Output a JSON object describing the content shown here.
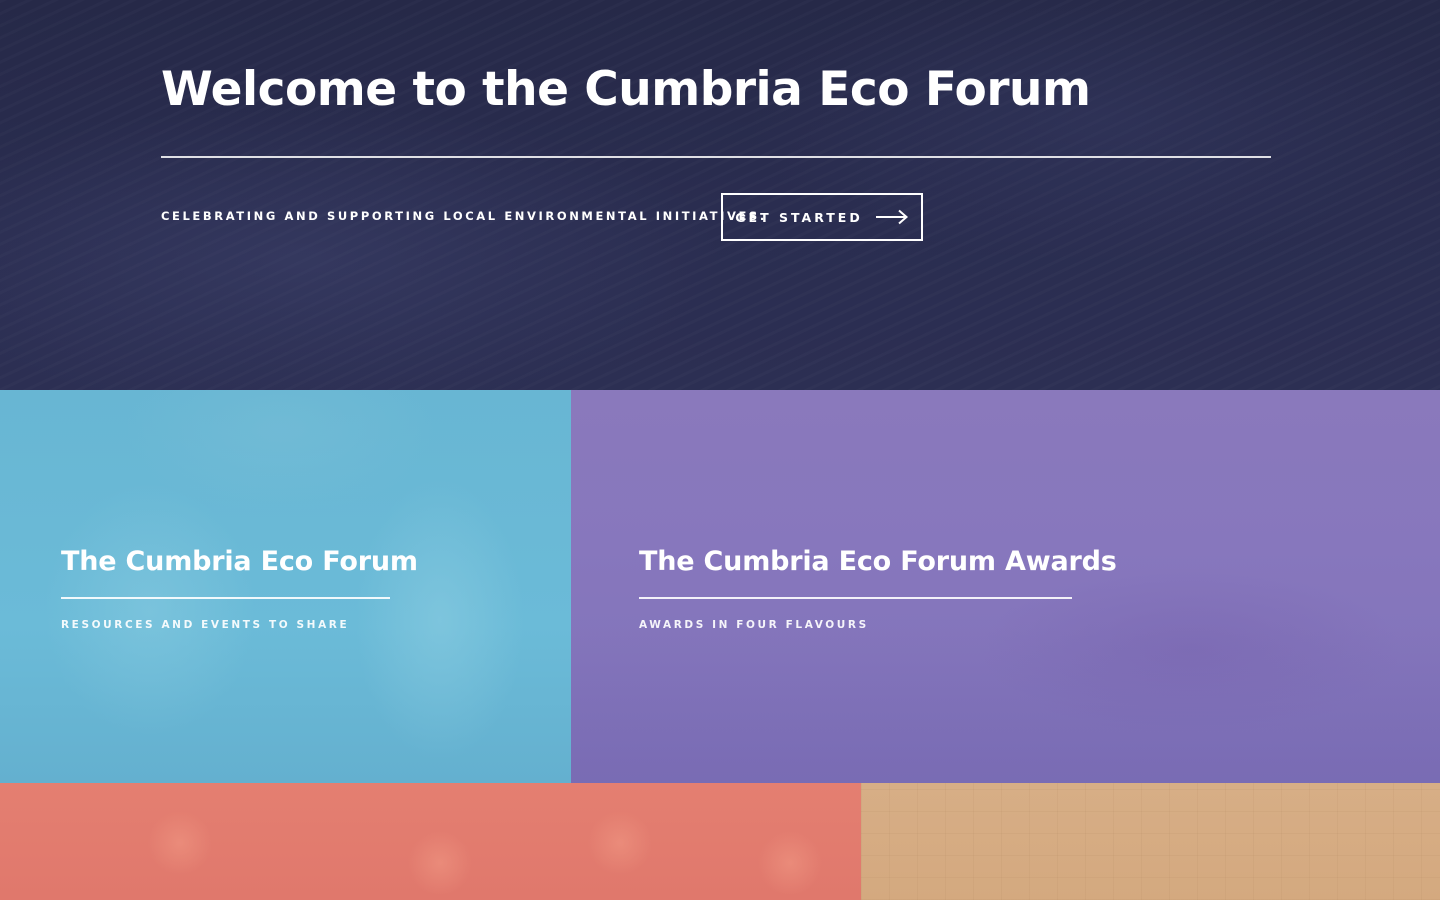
{
  "hero": {
    "title": "Welcome to the Cumbria Eco Forum",
    "tagline": "CELEBRATING AND SUPPORTING LOCAL ENVIRONMENTAL INITIATIVES.",
    "cta_label": "GET STARTED",
    "cta_icon": "arrow-right-icon"
  },
  "tiles": [
    {
      "title": "The Cumbria Eco Forum",
      "subtitle": "RESOURCES AND EVENTS TO SHARE",
      "color": "#68b6d3"
    },
    {
      "title": "The Cumbria Eco Forum Awards",
      "subtitle": "AWARDS IN FOUR FLAVOURS",
      "color": "#8a79bc"
    },
    {
      "color": "#e47f71"
    },
    {
      "color": "#d7ae86"
    }
  ],
  "colors": {
    "hero_background": "#25284a",
    "text": "#ffffff"
  }
}
